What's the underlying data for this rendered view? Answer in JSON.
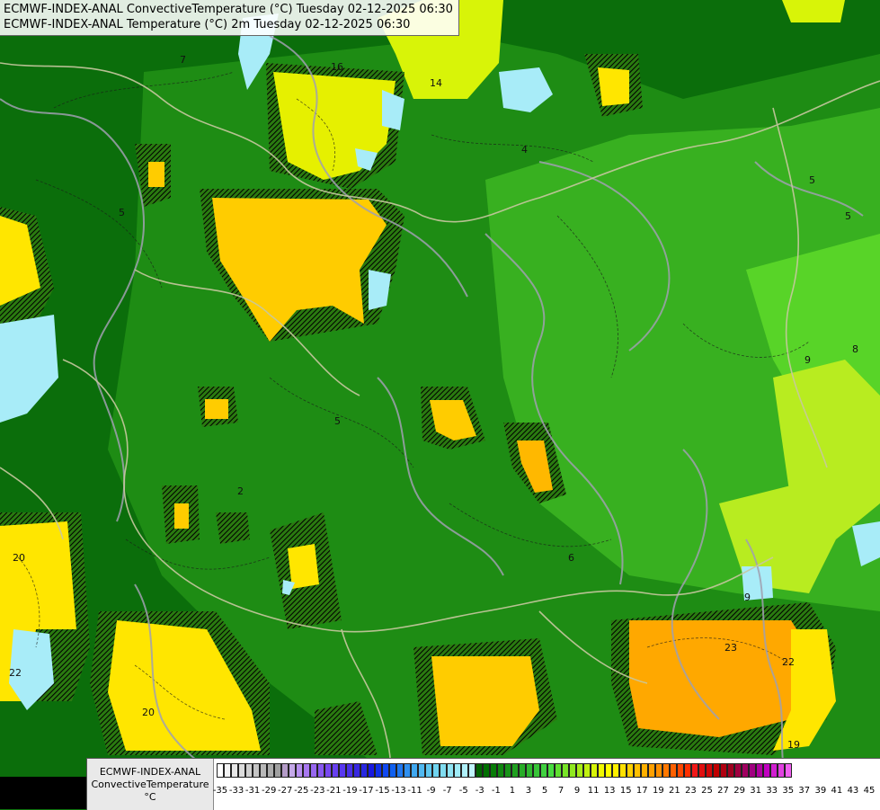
{
  "header": {
    "line1": "ECMWF-INDEX-ANAL ConvectiveTemperature (°C) Tuesday 02-12-2025 06:30",
    "line2": "ECMWF-INDEX-ANAL Temperature (°C) 2m Tuesday 02-12-2025 06:30"
  },
  "legend": {
    "line1": "ECMWF-INDEX-ANAL",
    "line2": "ConvectiveTemperature",
    "unit": "°C",
    "tick_labels": [
      "-35",
      "-33",
      "-31",
      "-29",
      "-27",
      "-25",
      "-23",
      "-21",
      "-19",
      "-17",
      "-15",
      "-13",
      "-11",
      "-9",
      "-7",
      "-5",
      "-3",
      "-1",
      "1",
      "3",
      "5",
      "7",
      "9",
      "11",
      "13",
      "15",
      "17",
      "19",
      "21",
      "23",
      "25",
      "27",
      "29",
      "31",
      "33",
      "35",
      "37",
      "39",
      "41",
      "43",
      "45"
    ],
    "colors": [
      "#ffffff",
      "#f4f4f4",
      "#e8e8e8",
      "#dcdcdc",
      "#d0d0d0",
      "#c4c4c4",
      "#b8b8b8",
      "#acacac",
      "#a0a0a0",
      "#b49cc8",
      "#c4a8e8",
      "#b890f0",
      "#a878f0",
      "#9868f0",
      "#8858f0",
      "#7848f0",
      "#6840f0",
      "#5838f0",
      "#4830e8",
      "#3828e0",
      "#2828e0",
      "#1818e0",
      "#1030e8",
      "#1048f0",
      "#1060f0",
      "#2078f0",
      "#3090f0",
      "#40a8f0",
      "#50b8f0",
      "#60c8f0",
      "#70d4f0",
      "#80dcf0",
      "#90e4f4",
      "#a0ecf8",
      "#b0f0fa",
      "#c0f4fc",
      "#006400",
      "#007000",
      "#087c08",
      "#108810",
      "#189418",
      "#20a020",
      "#28ac28",
      "#30b830",
      "#38c438",
      "#40d040",
      "#48dc40",
      "#60e030",
      "#78e428",
      "#90e820",
      "#a8ec18",
      "#c0f010",
      "#d8f408",
      "#f0f800",
      "#ffff00",
      "#fff000",
      "#ffe000",
      "#ffd000",
      "#ffc000",
      "#ffb000",
      "#ffa000",
      "#ff9000",
      "#ff7800",
      "#ff6000",
      "#ff4800",
      "#ff3000",
      "#f01818",
      "#e01010",
      "#d00808",
      "#c00000",
      "#b00010",
      "#a00020",
      "#a00040",
      "#a00060",
      "#a00080",
      "#b000a0",
      "#c000c0",
      "#d020d0",
      "#e040e0",
      "#f060f0"
    ]
  },
  "map": {
    "contour_labels": [
      {
        "text": "16"
      },
      {
        "text": "14"
      },
      {
        "text": "4"
      },
      {
        "text": "5"
      },
      {
        "text": "5"
      },
      {
        "text": "9"
      },
      {
        "text": "8"
      },
      {
        "text": "20"
      },
      {
        "text": "22"
      },
      {
        "text": "20"
      },
      {
        "text": "23"
      },
      {
        "text": "22"
      },
      {
        "text": "19"
      },
      {
        "text": "9"
      },
      {
        "text": "6"
      },
      {
        "text": "5"
      },
      {
        "text": "2"
      },
      {
        "text": "5"
      },
      {
        "text": "7"
      }
    ],
    "colors": {
      "dark_green": "#0b6e0b",
      "mid_green": "#1e8c14",
      "light_green": "#38b020",
      "bright_green": "#58d428",
      "lime": "#b8ec20",
      "yellow": "#ffe600",
      "gold": "#ffcc00",
      "orange": "#ffa800",
      "light_blue": "#a8ecf8",
      "border_line": "#c8c8a0",
      "river_line": "#a0a0b0",
      "contour_line": "#1a1a1a"
    }
  }
}
